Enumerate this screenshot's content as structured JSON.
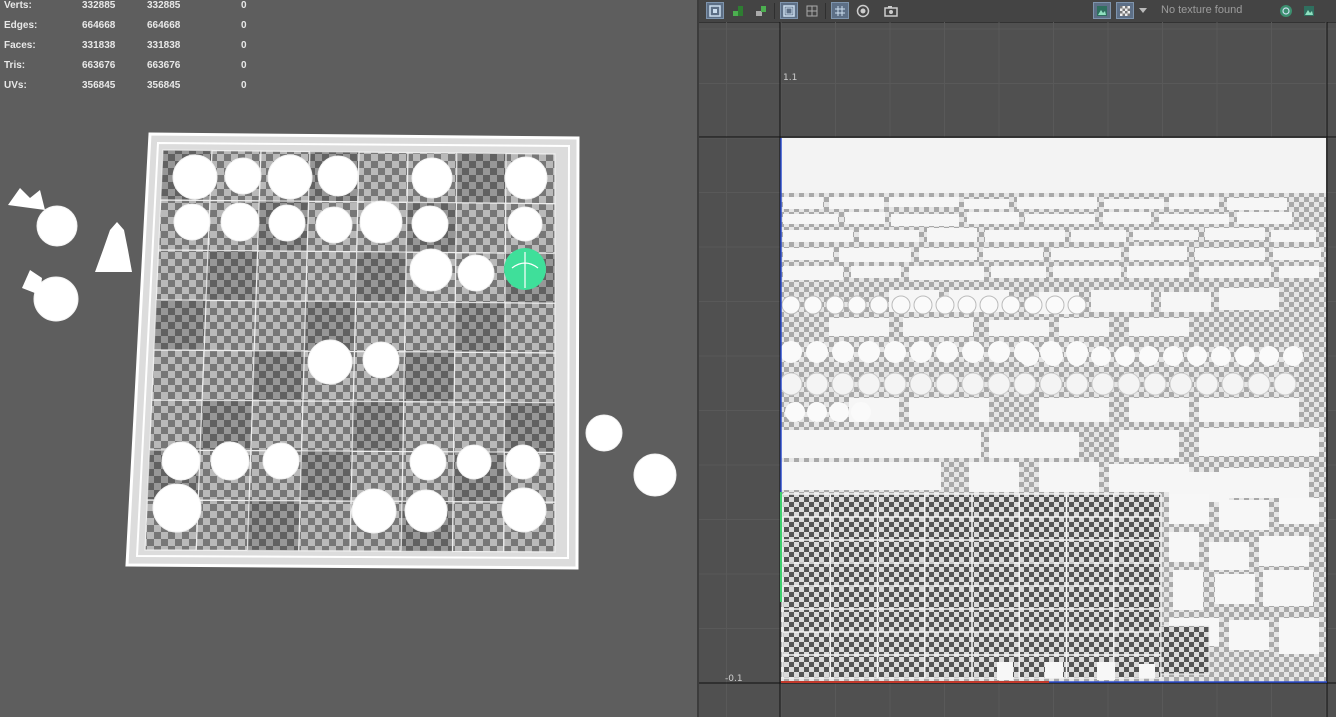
{
  "stats": {
    "rows": [
      {
        "label": "Verts:",
        "a": "332885",
        "b": "332885",
        "c": "0"
      },
      {
        "label": "Edges:",
        "a": "664668",
        "b": "664668",
        "c": "0"
      },
      {
        "label": "Faces:",
        "a": "331838",
        "b": "331838",
        "c": "0"
      },
      {
        "label": "Tris:",
        "a": "663676",
        "b": "663676",
        "c": "0"
      },
      {
        "label": "UVs:",
        "a": "356845",
        "b": "356845",
        "c": "0"
      }
    ]
  },
  "uv_editor": {
    "texture_status": "No texture found",
    "axis_labels": {
      "top": "1.1",
      "bottom": "-0.1"
    },
    "toolbar_icons": [
      "uv-shell-icon",
      "isolate-icon",
      "select-icon",
      "shaded-icon",
      "wireframe-icon",
      "grid-icon",
      "pixel-snap-icon",
      "snapshot-icon",
      "image-display-icon",
      "checker-icon",
      "texture-menu-icon",
      "rgb-channel-icon",
      "alpha-channel-icon"
    ],
    "colors": {
      "selected_piece": "#3fdf9a",
      "accent": "#5d6f86",
      "u_axis": "#c0392b",
      "v_axis": "#2e4fcf"
    }
  }
}
